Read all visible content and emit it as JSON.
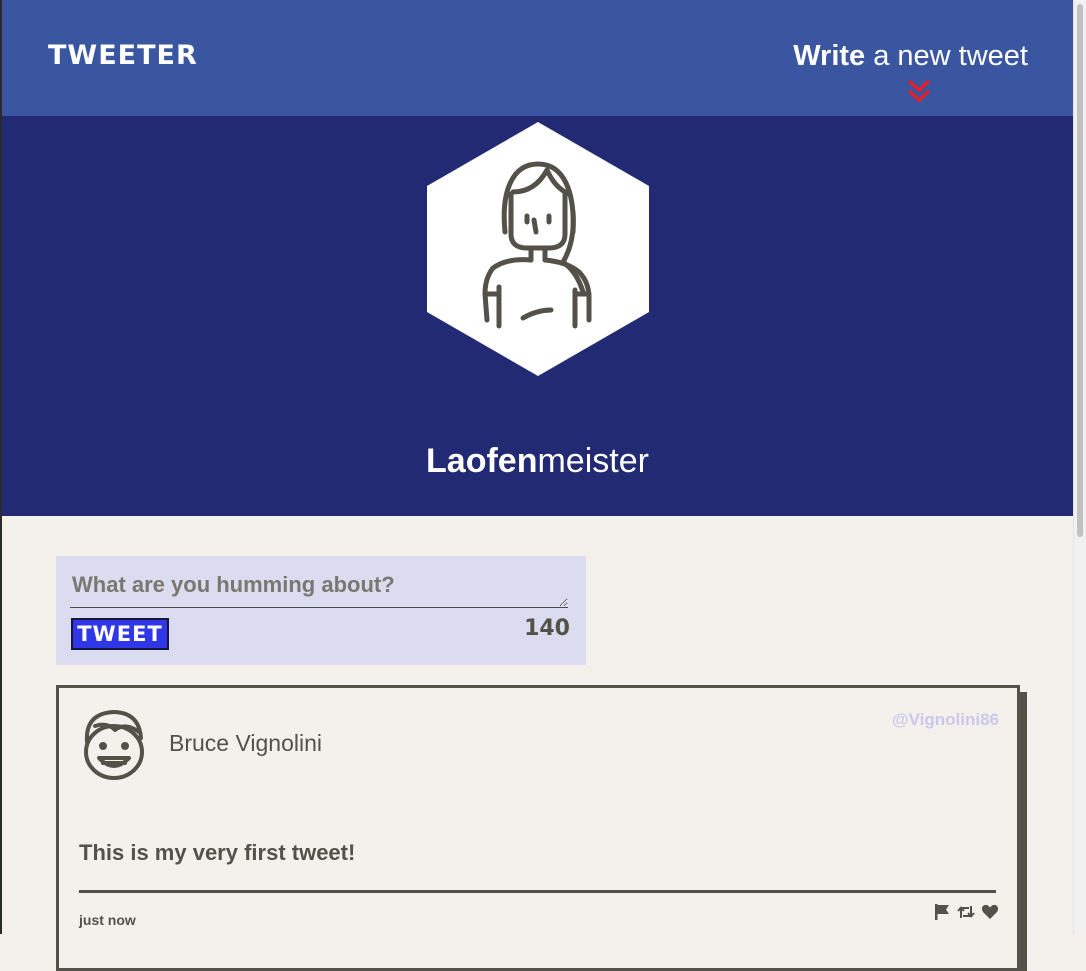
{
  "nav": {
    "logo": "TWEETER",
    "write_bold": "Write",
    "write_rest": " a new tweet",
    "chevron_color": "#e0202a"
  },
  "profile": {
    "name_first": "Laofen",
    "name_second": "meister",
    "avatar_icon": "woman-avatar-icon"
  },
  "composer": {
    "placeholder": "What are you humming about?",
    "value": "",
    "button_label": "TWEET",
    "counter": "140"
  },
  "tweets": [
    {
      "author": "Bruce Vignolini",
      "handle": "@Vignolini86",
      "text": "This is my very first tweet!",
      "time": "just now",
      "avatar_icon": "man-avatar-icon",
      "actions": [
        "flag-icon",
        "retweet-icon",
        "heart-icon"
      ]
    }
  ],
  "colors": {
    "nav_bg": "#3b56a1",
    "profile_bg": "#222a73",
    "page_bg": "#f4f1ec",
    "text_dark": "#545149",
    "button_bg": "#2f37e8",
    "composer_bg": "#dcdcf0",
    "handle": "#c8c9ec"
  }
}
